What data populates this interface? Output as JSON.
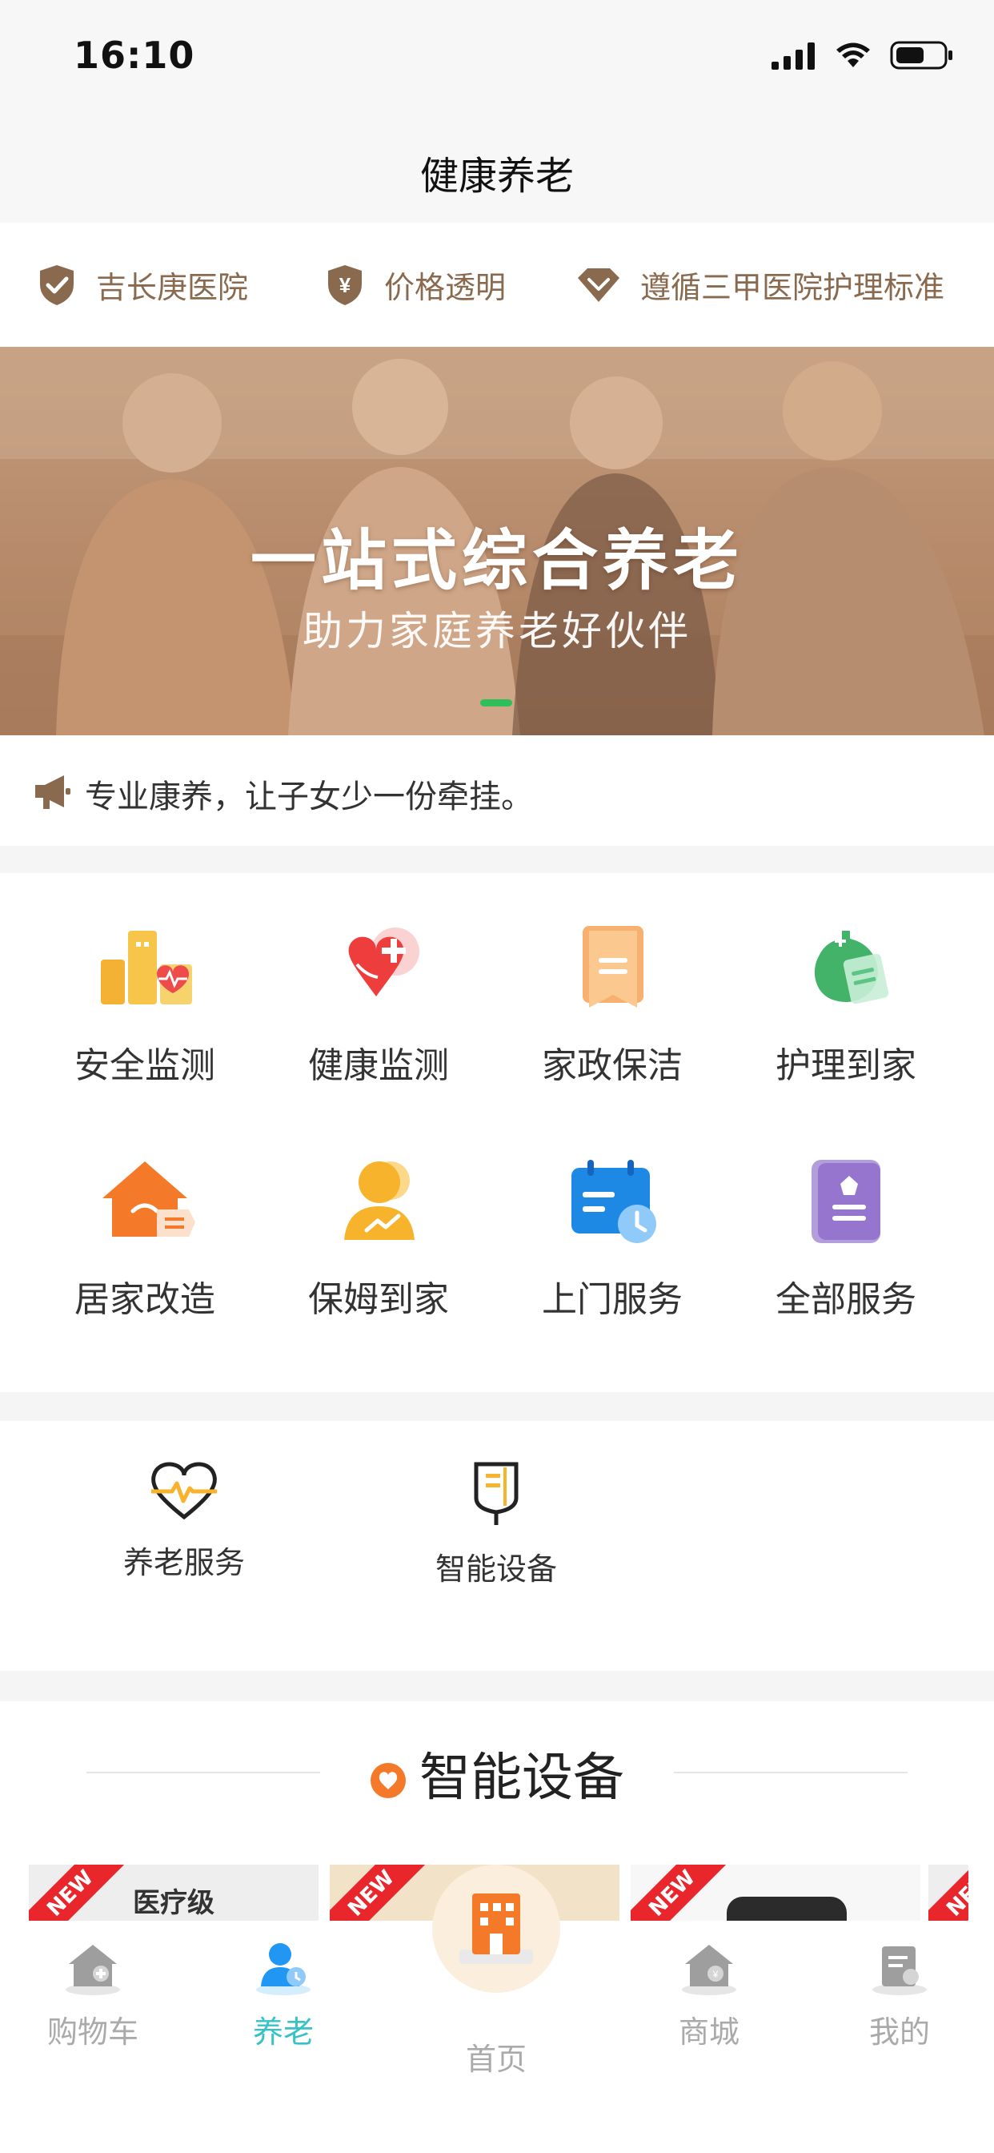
{
  "status_bar": {
    "time": "16:10"
  },
  "nav": {
    "title": "健康养老"
  },
  "trust": [
    {
      "label": "吉长庚医院",
      "icon": "check-shield-icon"
    },
    {
      "label": "价格透明",
      "icon": "yen-shield-icon"
    },
    {
      "label": "遵循三甲医院护理标准",
      "icon": "diamond-icon"
    }
  ],
  "banner": {
    "title": "一站式综合养老",
    "subtitle": "助力家庭养老好伙伴",
    "active_dot": 1
  },
  "notice": {
    "text": "专业康养，让子女少一份牵挂。"
  },
  "services": [
    {
      "label": "安全监测",
      "icon": "safety-monitor-icon"
    },
    {
      "label": "健康监测",
      "icon": "health-monitor-icon"
    },
    {
      "label": "家政保洁",
      "icon": "housekeeping-icon"
    },
    {
      "label": "护理到家",
      "icon": "home-nursing-icon"
    },
    {
      "label": "居家改造",
      "icon": "home-renovation-icon"
    },
    {
      "label": "保姆到家",
      "icon": "nanny-icon"
    },
    {
      "label": "上门服务",
      "icon": "door-service-icon"
    },
    {
      "label": "全部服务",
      "icon": "all-services-icon"
    }
  ],
  "categories": [
    {
      "label": "养老服务",
      "icon": "heartbeat-icon"
    },
    {
      "label": "智能设备",
      "icon": "iv-drip-icon"
    }
  ],
  "section": {
    "title": "智能设备",
    "cards": [
      {
        "badge": "NEW",
        "text": "医疗级"
      },
      {
        "badge": "NEW"
      },
      {
        "badge": "NEW"
      },
      {
        "badge": "NEW"
      }
    ]
  },
  "tabbar": [
    {
      "label": "购物车",
      "icon": "cart-house-icon",
      "active": false
    },
    {
      "label": "养老",
      "icon": "elder-care-icon",
      "active": true
    },
    {
      "label": "首页",
      "icon": "home-building-icon",
      "active": false
    },
    {
      "label": "商城",
      "icon": "mall-house-icon",
      "active": false
    },
    {
      "label": "我的",
      "icon": "profile-doc-icon",
      "active": false
    }
  ],
  "colors": {
    "brand_brown": "#8a6a4f",
    "accent_green": "#2fbf5a",
    "accent_orange": "#f47a2a",
    "tab_active": "#36c2c6",
    "tab_inactive": "#aaaaaa",
    "badge_red": "#e8262c"
  }
}
